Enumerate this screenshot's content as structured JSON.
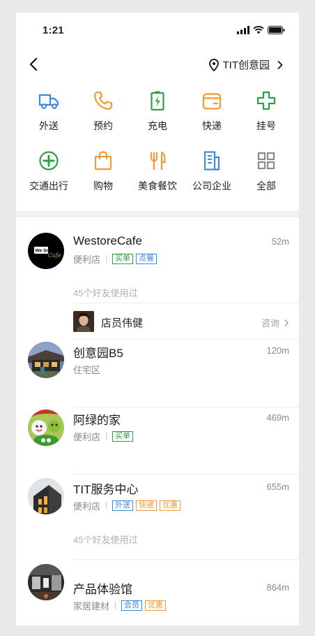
{
  "status": {
    "time": "1:21"
  },
  "nav": {
    "location": "TIT创意园"
  },
  "categories": [
    {
      "label": "外送",
      "icon": "delivery-truck-icon",
      "color": "#3a88e0"
    },
    {
      "label": "预约",
      "icon": "phone-icon",
      "color": "#f29a38"
    },
    {
      "label": "充电",
      "icon": "battery-charge-icon",
      "color": "#2ea043"
    },
    {
      "label": "快递",
      "icon": "wallet-icon",
      "color": "#f29a38"
    },
    {
      "label": "挂号",
      "icon": "medical-cross-icon",
      "color": "#2ea043"
    },
    {
      "label": "交通出行",
      "icon": "plus-circle-icon",
      "color": "#2ea043"
    },
    {
      "label": "购物",
      "icon": "shopping-bag-icon",
      "color": "#f29a38"
    },
    {
      "label": "美食餐饮",
      "icon": "fork-knife-icon",
      "color": "#f29a38"
    },
    {
      "label": "公司企业",
      "icon": "building-icon",
      "color": "#3a88e0"
    },
    {
      "label": "全部",
      "icon": "grid-icon",
      "color": "#8a8a8a"
    }
  ],
  "places": [
    {
      "name": "WestoreCafe",
      "distance": "52m",
      "type": "便利店",
      "tags": [
        {
          "text": "买单",
          "color": "green"
        },
        {
          "text": "点餐",
          "color": "blue"
        }
      ],
      "friends": "45个好友使用过",
      "avatar_text": [
        "We Store",
        "Cafe"
      ],
      "staff": {
        "name": "店员伟健",
        "action": "咨询"
      }
    },
    {
      "name": "创意园B5",
      "distance": "120m",
      "type": "住宅区",
      "tags": []
    },
    {
      "name": "阿绿的家",
      "distance": "469m",
      "type": "便利店",
      "tags": [
        {
          "text": "买单",
          "color": "green"
        }
      ]
    },
    {
      "name": "TIT服务中心",
      "distance": "655m",
      "type": "便利店",
      "tags": [
        {
          "text": "外送",
          "color": "blue"
        },
        {
          "text": "快递",
          "color": "orange"
        },
        {
          "text": "优惠",
          "color": "orange"
        }
      ],
      "friends": "45个好友使用过"
    },
    {
      "name": "产品体验馆",
      "distance": "864m",
      "type": "家居建材",
      "tags": [
        {
          "text": "会员",
          "color": "blue"
        },
        {
          "text": "优惠",
          "color": "orange"
        }
      ]
    }
  ]
}
